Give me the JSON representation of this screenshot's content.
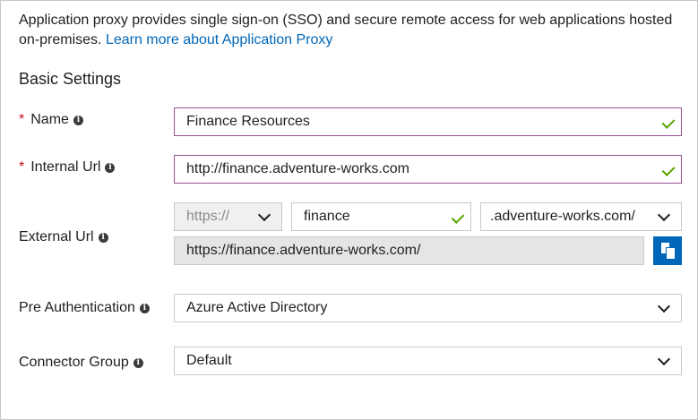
{
  "intro": {
    "text": "Application proxy provides single sign-on (SSO) and secure remote access for web applications hosted on-premises.",
    "link": "Learn more about Application Proxy"
  },
  "section_title": "Basic Settings",
  "name": {
    "label": "Name",
    "required_mark": "*",
    "info_icon": "i",
    "value": "Finance Resources"
  },
  "internal_url": {
    "label": "Internal Url",
    "required_mark": "*",
    "info_icon": "i",
    "value": "http://finance.adventure-works.com"
  },
  "external_url": {
    "label": "External Url",
    "info_icon": "i",
    "scheme": "https://",
    "subdomain": "finance",
    "domain": ".adventure-works.com/",
    "full_url": "https://finance.adventure-works.com/"
  },
  "pre_authentication": {
    "label": "Pre Authentication",
    "info_icon": "i",
    "value": "Azure Active Directory"
  },
  "connector_group": {
    "label": "Connector Group",
    "info_icon": "i",
    "value": "Default"
  },
  "colors": {
    "link": "#0067b8",
    "required": "#c50f1f",
    "valid_check": "#57a300",
    "focus_border": "#9b4f96",
    "copy_button": "#0067b8"
  }
}
